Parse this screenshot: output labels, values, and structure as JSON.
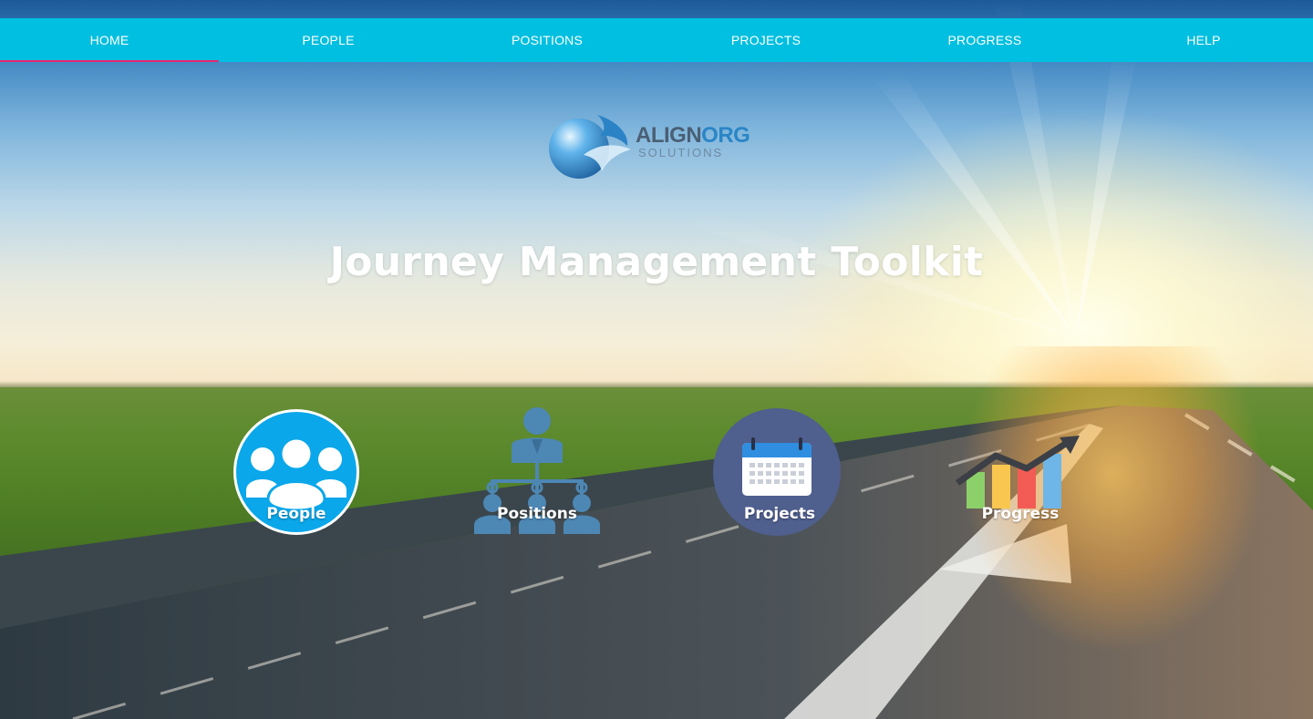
{
  "nav": {
    "items": [
      {
        "label": "HOME",
        "active": true
      },
      {
        "label": "PEOPLE"
      },
      {
        "label": "POSITIONS"
      },
      {
        "label": "PROJECTS"
      },
      {
        "label": "PROGRESS"
      },
      {
        "label": "HELP"
      }
    ]
  },
  "logo": {
    "word_a": "ALIGN",
    "word_b": "ORG",
    "sub": "SOLUTIONS"
  },
  "hero": {
    "title": "Journey Management Toolkit"
  },
  "tiles": [
    {
      "label": "People",
      "icon": "people-icon"
    },
    {
      "label": "Positions",
      "icon": "org-chart-icon"
    },
    {
      "label": "Projects",
      "icon": "calendar-icon"
    },
    {
      "label": "Progress",
      "icon": "bar-chart-icon"
    }
  ],
  "colors": {
    "nav_bg": "#00bfe0",
    "nav_active_underline": "#e8286e",
    "people_blue": "#0aa7ea",
    "positions_blue": "#4d87b4",
    "projects_navy": "#4f5f8e",
    "calendar_blue": "#2f8ee0"
  }
}
